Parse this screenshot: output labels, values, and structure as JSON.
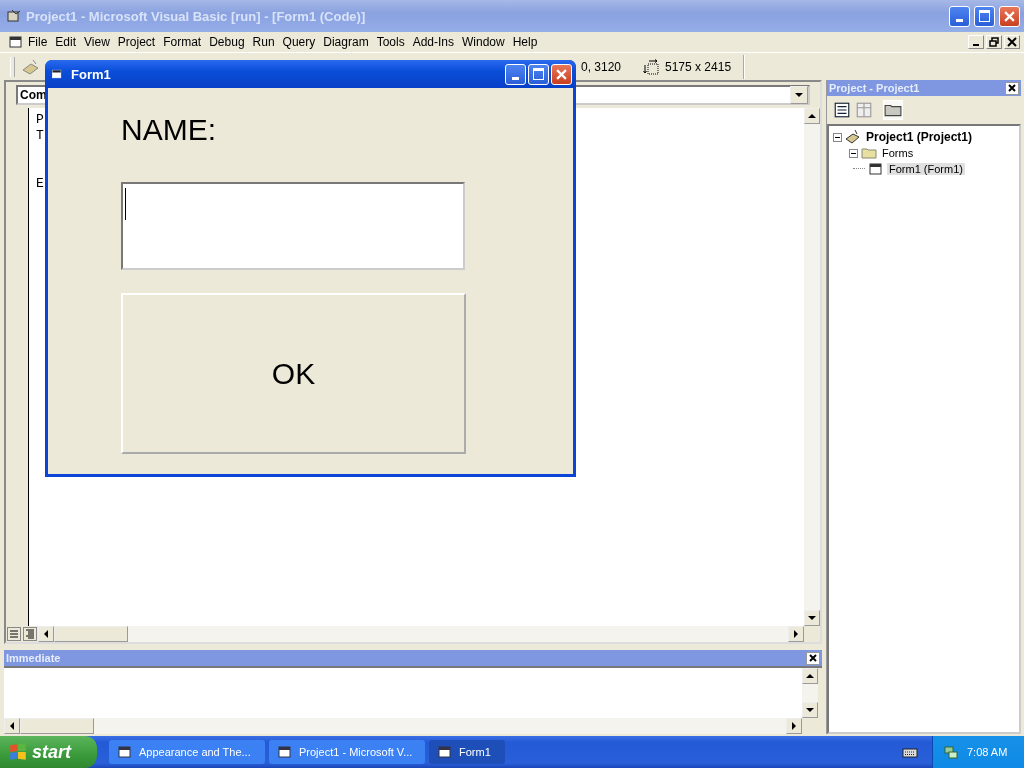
{
  "main_window": {
    "title": "Project1 - Microsoft Visual Basic [run] - [Form1 (Code)]"
  },
  "menu": [
    {
      "label": "File"
    },
    {
      "label": "Edit"
    },
    {
      "label": "View"
    },
    {
      "label": "Project"
    },
    {
      "label": "Format"
    },
    {
      "label": "Debug"
    },
    {
      "label": "Run"
    },
    {
      "label": "Query"
    },
    {
      "label": "Diagram"
    },
    {
      "label": "Tools"
    },
    {
      "label": "Add-Ins"
    },
    {
      "label": "Window"
    },
    {
      "label": "Help"
    }
  ],
  "toolbar": {
    "position": "0, 3120",
    "size": "5175 x 2415"
  },
  "code_window": {
    "object_combo": "Com",
    "code_lines": [
      {
        "text": "P"
      },
      {
        "text": "T"
      },
      {
        "text": "E"
      }
    ]
  },
  "immediate": {
    "title": "Immediate"
  },
  "project_panel": {
    "title": "Project - Project1",
    "tree": [
      {
        "label": "Project1 (Project1)",
        "selected": false,
        "expanded": true,
        "children": [
          {
            "label": "Forms",
            "selected": false,
            "expanded": true,
            "children": [
              {
                "label": "Form1 (Form1)",
                "selected": true
              }
            ]
          }
        ]
      }
    ]
  },
  "form_window": {
    "title": "Form1",
    "label": "NAME:",
    "button": "OK"
  },
  "taskbar": {
    "start": "start",
    "tasks": [
      {
        "label": "Appearance and The...",
        "selected": false
      },
      {
        "label": "Project1 - Microsoft V...",
        "selected": false
      },
      {
        "label": "Form1",
        "selected": true
      }
    ],
    "clock": "7:08 AM"
  }
}
